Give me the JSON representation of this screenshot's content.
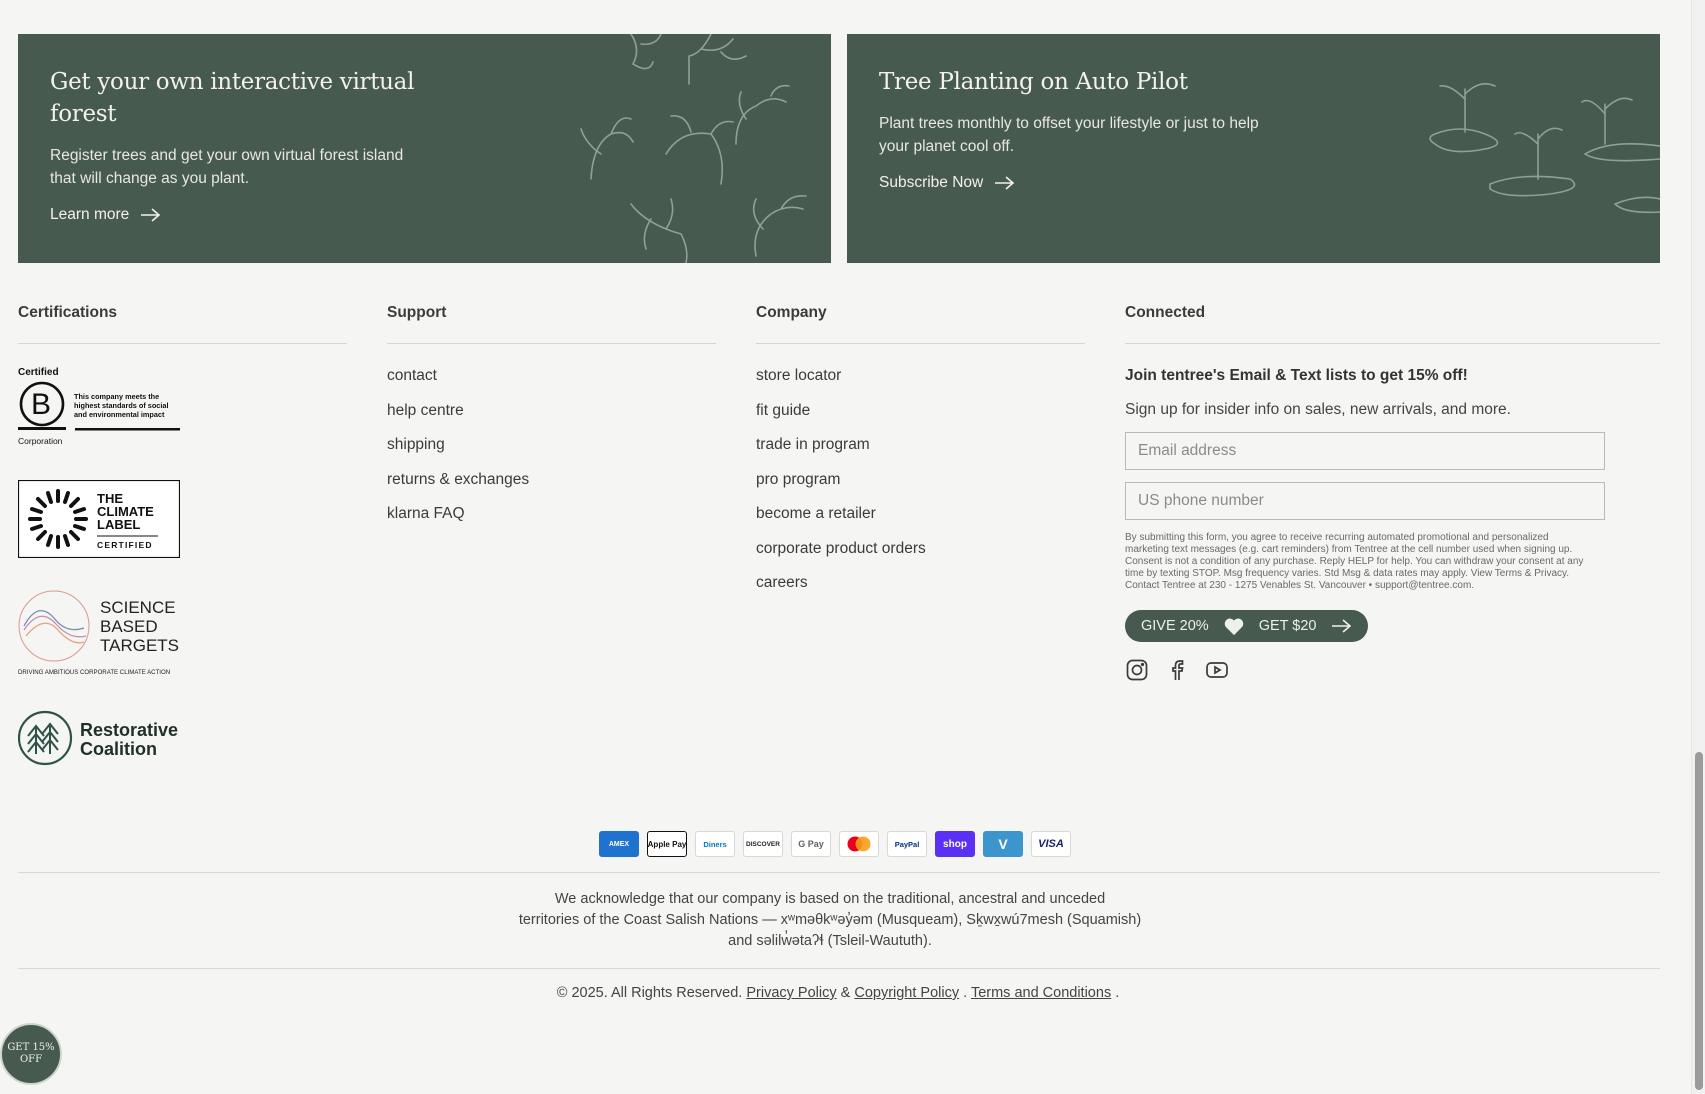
{
  "promos": [
    {
      "title": "Get your own interactive virtual forest",
      "body": "Register trees and get your own virtual forest island that will change as you plant.",
      "cta": "Learn more"
    },
    {
      "title": "Tree Planting on Auto Pilot",
      "body": "Plant trees monthly to offset your lifestyle or just to help your planet cool off.",
      "cta": "Subscribe Now"
    }
  ],
  "certifications": {
    "title": "Certifications",
    "bcorp": {
      "top": "Certified",
      "bottom": "Corporation",
      "text": "This company meets the highest standards of social and environmental impact"
    },
    "climate": [
      "THE",
      "CLIMATE",
      "LABEL",
      "CERTIFIED"
    ],
    "sbt": {
      "lines": [
        "SCIENCE",
        "BASED",
        "TARGETS"
      ],
      "tag": "DRIVING AMBITIOUS CORPORATE CLIMATE ACTION"
    },
    "restorative": [
      "Restorative",
      "Coalition"
    ]
  },
  "support": {
    "title": "Support",
    "links": [
      "contact",
      "help centre",
      "shipping",
      "returns & exchanges",
      "klarna FAQ"
    ]
  },
  "company": {
    "title": "Company",
    "links": [
      "store locator",
      "fit guide",
      "trade in program",
      "pro program",
      "become a retailer",
      "corporate product orders",
      "careers"
    ]
  },
  "connected": {
    "title": "Connected",
    "lead": "Join tentree's Email & Text lists to get 15% off!",
    "sub": "Sign up for insider info on sales, new arrivals, and more.",
    "email_placeholder": "Email address",
    "phone_placeholder": "US phone number",
    "legal": "By submitting this form, you agree to receive recurring automated promotional and personalized marketing text messages (e.g. cart reminders) from Tentree at the cell number used when signing up. Consent is not a condition of any purchase. Reply HELP for help. You can withdraw your consent at any time by texting STOP. Msg frequency varies. Std Msg & data rates may apply. View Terms & Privacy. Contact Tentree at 230 - 1275 Venables St. Vancouver • support@tentree.com.",
    "give": "GIVE 20%",
    "get": "GET $20"
  },
  "payments": [
    "AMEX",
    "Apple Pay",
    "Diners",
    "DISCOVER",
    "G Pay",
    "Mastercard",
    "PayPal",
    "shop",
    "V",
    "VISA"
  ],
  "acknowledgement": [
    "We acknowledge that our company is based on the traditional, ancestral and unceded",
    "territories of the Coast Salish Nations — xʷməθkʷəy̓əm (Musqueam), Sḵwx̱wú7mesh (Squamish)",
    "and səlilw̓ətaʔɬ (Tsleil-Waututh)."
  ],
  "copyright": {
    "prefix": "© 2025. All Rights Reserved.",
    "privacy": "Privacy Policy",
    "amp": "&",
    "copy_policy": "Copyright Policy",
    "dot": ".",
    "terms": "Terms and Conditions",
    "end": "."
  },
  "badge": {
    "line1": "GET 15%",
    "line2": "OFF"
  },
  "colors": {
    "forest": "#475a50",
    "background": "#f5f5f3"
  }
}
